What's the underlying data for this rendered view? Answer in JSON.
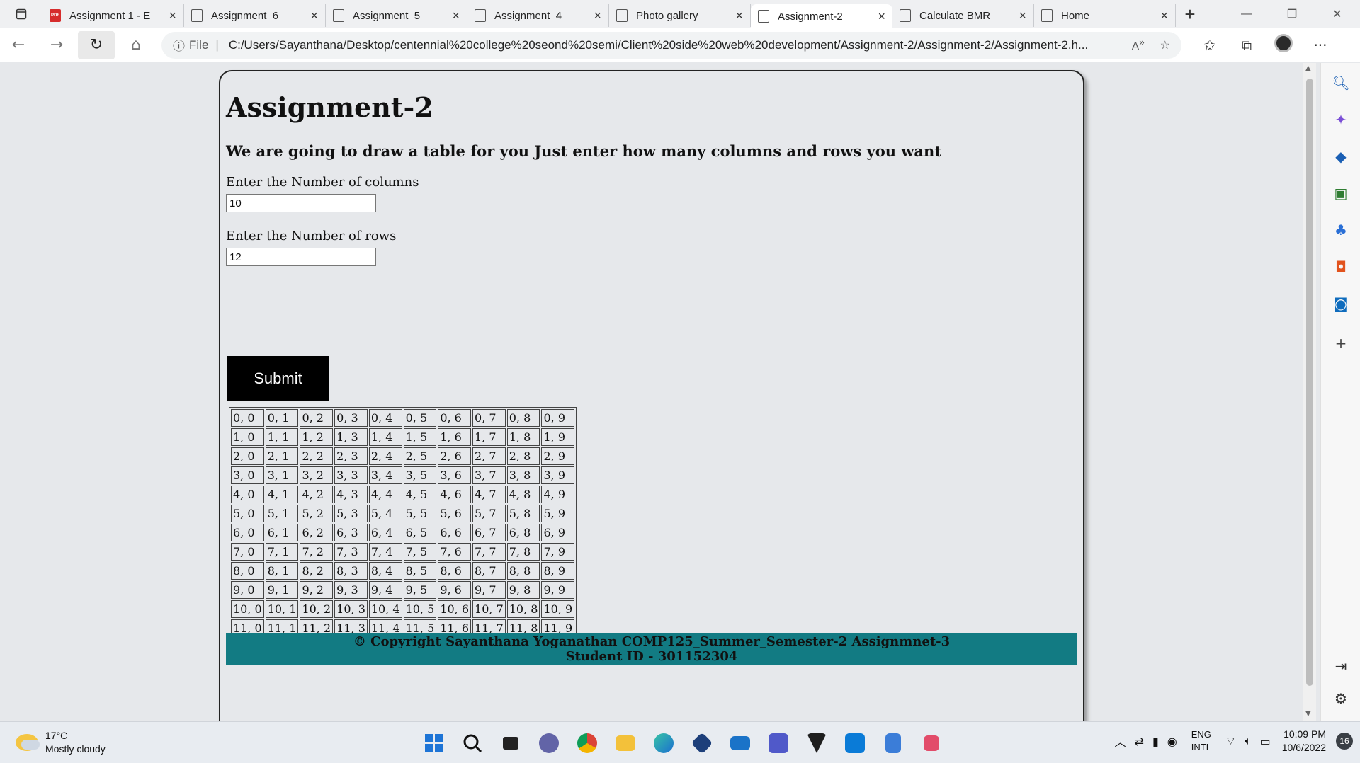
{
  "browser": {
    "tabs": [
      {
        "label": "Assignment 1 - E",
        "icon": "pdf-icon"
      },
      {
        "label": "Assignment_6",
        "icon": "page-icon"
      },
      {
        "label": "Assignment_5",
        "icon": "page-icon"
      },
      {
        "label": "Assignment_4",
        "icon": "page-icon"
      },
      {
        "label": "Photo gallery",
        "icon": "page-icon"
      },
      {
        "label": "Assignment-2",
        "icon": "page-icon",
        "active": true
      },
      {
        "label": "Calculate BMR",
        "icon": "page-icon"
      },
      {
        "label": "Home",
        "icon": "page-icon"
      }
    ],
    "url_scheme": "File",
    "url_path": "C:/Users/Sayanthana/Desktop/centennial%20college%20seond%20semi/Client%20side%20web%20development/Assignment-2/Assignment-2/Assignment-2.h..."
  },
  "page": {
    "title": "Assignment-2",
    "subtitle": "We are going to draw a table for you Just enter how many columns and rows you want",
    "columns_label": "Enter the Number of columns",
    "columns_value": "10",
    "rows_label": "Enter the Number of rows",
    "rows_value": "12",
    "submit_label": "Submit",
    "table_rows": [
      [
        "0, 0",
        "0, 1",
        "0, 2",
        "0, 3",
        "0, 4",
        "0, 5",
        "0, 6",
        "0, 7",
        "0, 8",
        "0, 9"
      ],
      [
        "1, 0",
        "1, 1",
        "1, 2",
        "1, 3",
        "1, 4",
        "1, 5",
        "1, 6",
        "1, 7",
        "1, 8",
        "1, 9"
      ],
      [
        "2, 0",
        "2, 1",
        "2, 2",
        "2, 3",
        "2, 4",
        "2, 5",
        "2, 6",
        "2, 7",
        "2, 8",
        "2, 9"
      ],
      [
        "3, 0",
        "3, 1",
        "3, 2",
        "3, 3",
        "3, 4",
        "3, 5",
        "3, 6",
        "3, 7",
        "3, 8",
        "3, 9"
      ],
      [
        "4, 0",
        "4, 1",
        "4, 2",
        "4, 3",
        "4, 4",
        "4, 5",
        "4, 6",
        "4, 7",
        "4, 8",
        "4, 9"
      ],
      [
        "5, 0",
        "5, 1",
        "5, 2",
        "5, 3",
        "5, 4",
        "5, 5",
        "5, 6",
        "5, 7",
        "5, 8",
        "5, 9"
      ],
      [
        "6, 0",
        "6, 1",
        "6, 2",
        "6, 3",
        "6, 4",
        "6, 5",
        "6, 6",
        "6, 7",
        "6, 8",
        "6, 9"
      ],
      [
        "7, 0",
        "7, 1",
        "7, 2",
        "7, 3",
        "7, 4",
        "7, 5",
        "7, 6",
        "7, 7",
        "7, 8",
        "7, 9"
      ],
      [
        "8, 0",
        "8, 1",
        "8, 2",
        "8, 3",
        "8, 4",
        "8, 5",
        "8, 6",
        "8, 7",
        "8, 8",
        "8, 9"
      ],
      [
        "9, 0",
        "9, 1",
        "9, 2",
        "9, 3",
        "9, 4",
        "9, 5",
        "9, 6",
        "9, 7",
        "9, 8",
        "9, 9"
      ],
      [
        "10, 0",
        "10, 1",
        "10, 2",
        "10, 3",
        "10, 4",
        "10, 5",
        "10, 6",
        "10, 7",
        "10, 8",
        "10, 9"
      ],
      [
        "11, 0",
        "11, 1",
        "11, 2",
        "11, 3",
        "11, 4",
        "11, 5",
        "11, 6",
        "11, 7",
        "11, 8",
        "11, 9"
      ]
    ],
    "footer_line1": "© Copyright Sayanthana Yoganathan COMP125_Summer_Semester-2 Assignmnet-3",
    "footer_line2": "Student ID - 301152304",
    "footer_color": "#127b83"
  },
  "taskbar": {
    "weather_temp": "17°C",
    "weather_desc": "Mostly cloudy",
    "lang_line1": "ENG",
    "lang_line2": "INTL",
    "time": "10:09 PM",
    "date": "10/6/2022",
    "notification_count": "16"
  }
}
